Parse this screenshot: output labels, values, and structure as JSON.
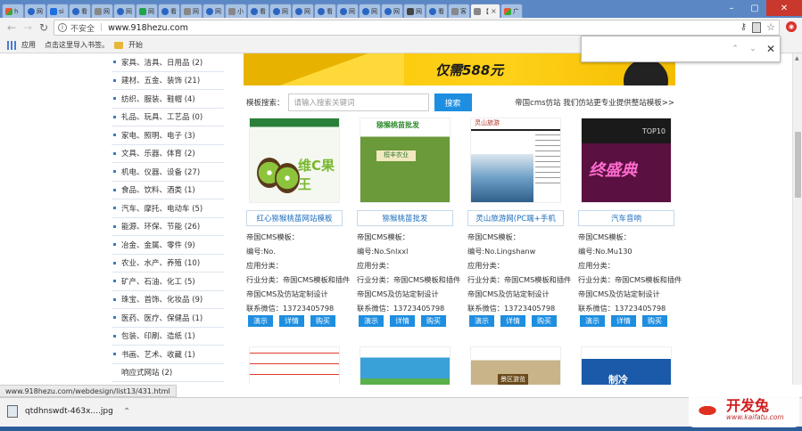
{
  "browser": {
    "tabs": [
      {
        "label": "h",
        "icon": "mix"
      },
      {
        "label": "网",
        "icon": "paw"
      },
      {
        "label": "si",
        "icon": "blue"
      },
      {
        "label": "看",
        "icon": "paw"
      },
      {
        "label": "网",
        "icon": "grey"
      },
      {
        "label": "网",
        "icon": "paw"
      },
      {
        "label": "网",
        "icon": "green"
      },
      {
        "label": "看",
        "icon": "paw"
      },
      {
        "label": "网",
        "icon": "grey"
      },
      {
        "label": "网",
        "icon": "paw"
      },
      {
        "label": "小",
        "icon": "grey"
      },
      {
        "label": "看",
        "icon": "paw"
      },
      {
        "label": "网",
        "icon": "paw"
      },
      {
        "label": "网",
        "icon": "paw"
      },
      {
        "label": "看",
        "icon": "paw"
      },
      {
        "label": "网",
        "icon": "paw"
      },
      {
        "label": "网",
        "icon": "paw"
      },
      {
        "label": "网",
        "icon": "paw"
      },
      {
        "label": "网",
        "icon": "dark"
      },
      {
        "label": "看",
        "icon": "paw"
      },
      {
        "label": "客",
        "icon": "grey"
      },
      {
        "label": "【",
        "icon": "grey",
        "active": true
      },
      {
        "label": "广",
        "icon": "mix"
      }
    ],
    "security_label": "不安全",
    "url": "www.918hezu.com",
    "bookmarks": {
      "apps_label": "应用",
      "import_label": "点击这里导入书签。",
      "start_label": "开始"
    },
    "find": {
      "value": "",
      "prev_label": "⌃",
      "next_label": "⌄",
      "close_label": "✕"
    },
    "status_url": "www.918hezu.com/webdesign/list13/431.html",
    "download_filename": "qtdhnswdt-463x....jpg"
  },
  "sidebar": {
    "categories": [
      {
        "label": "家具、洁具、日用品 (2)",
        "dot": true
      },
      {
        "label": "建材、五金、装饰 (21)",
        "dot": true
      },
      {
        "label": "纺织、服装、鞋帽 (4)",
        "dot": true
      },
      {
        "label": "礼品、玩具、工艺品 (0)",
        "dot": true
      },
      {
        "label": "家电、照明、电子 (3)",
        "dot": true
      },
      {
        "label": "文具、乐器、体育 (2)",
        "dot": true
      },
      {
        "label": "机电、仪器、设备 (27)",
        "dot": true
      },
      {
        "label": "食品、饮料、酒类 (1)",
        "dot": true
      },
      {
        "label": "汽车、摩托、电动车 (5)",
        "dot": true
      },
      {
        "label": "能源、环保、节能 (26)",
        "dot": true
      },
      {
        "label": "冶金、金属、零件 (9)",
        "dot": true
      },
      {
        "label": "农业、水产、养殖 (10)",
        "dot": true
      },
      {
        "label": "矿产、石油、化工 (5)",
        "dot": true
      },
      {
        "label": "珠宝、首饰、化妆品 (9)",
        "dot": true
      },
      {
        "label": "医药、医疗、保健品 (1)",
        "dot": true
      },
      {
        "label": "包装、印刷、造纸 (1)",
        "dot": true
      },
      {
        "label": "书画、艺术、收藏 (1)",
        "dot": true
      },
      {
        "label": "响应式网站 (2)",
        "dot": false
      }
    ]
  },
  "banner": {
    "text": "仅需588元"
  },
  "search": {
    "label": "模板搜索：",
    "placeholder": "请输入搜索关键词",
    "button": "搜索",
    "tagline": "帝国cms仿站 我们仿站更专业提供整站模板>>"
  },
  "templates": [
    {
      "title": "红心猕猴桃苗网站模板",
      "thumb_text": "维C果王",
      "cms": "帝国CMS模板：",
      "code": "编号:No.",
      "category": "应用分类：",
      "industry": "行业分类：帝国CMS模板和插件",
      "service": "帝国CMS及仿站定制设计",
      "contact": "联系微信：13723405798",
      "btn_demo": "演示",
      "btn_detail": "详情",
      "btn_buy": "购买"
    },
    {
      "title": "猕猴桃苗批发",
      "thumb_logo": "猕猴桃苗批发",
      "thumb_text": "桓丰农业",
      "cms": "帝国CMS模板：",
      "code": "编号:No.Snlxxl",
      "category": "应用分类：",
      "industry": "行业分类：帝国CMS模板和插件",
      "service": "帝国CMS及仿站定制设计",
      "contact": "联系微信：13723405798",
      "btn_demo": "演示",
      "btn_detail": "详情",
      "btn_buy": "购买"
    },
    {
      "title": "灵山旅游网(PC端+手机",
      "thumb_text": "灵山旅游",
      "cms": "帝国CMS模板：",
      "code": "编号:No.Lingshanw",
      "category": "应用分类：",
      "industry": "行业分类：帝国CMS模板和插件",
      "service": "帝国CMS及仿站定制设计",
      "contact": "联系微信：13723405798",
      "btn_demo": "演示",
      "btn_detail": "详情",
      "btn_buy": "购买"
    },
    {
      "title": "汽车音响",
      "thumb_text": "终盛典",
      "thumb_badge": "TOP10",
      "cms": "帝国CMS模板：",
      "code": "编号:No.Mu130",
      "category": "应用分类：",
      "industry": "行业分类：帝国CMS模板和插件",
      "service": "帝国CMS及仿站定制设计",
      "contact": "联系微信：13723405798",
      "btn_demo": "演示",
      "btn_detail": "详情",
      "btn_buy": "购买"
    }
  ],
  "row2_thumbs": [
    {
      "text": ""
    },
    {
      "text": ""
    },
    {
      "text": "景区游览"
    },
    {
      "text": "制冷"
    }
  ],
  "watermark": {
    "title": "开发兔",
    "url": "www.kaifatu.com"
  },
  "colors": {
    "accent": "#1e8ee0",
    "tabstrip": "#5b87c5",
    "banner": "#f6c400",
    "link": "#1a6bbd"
  }
}
